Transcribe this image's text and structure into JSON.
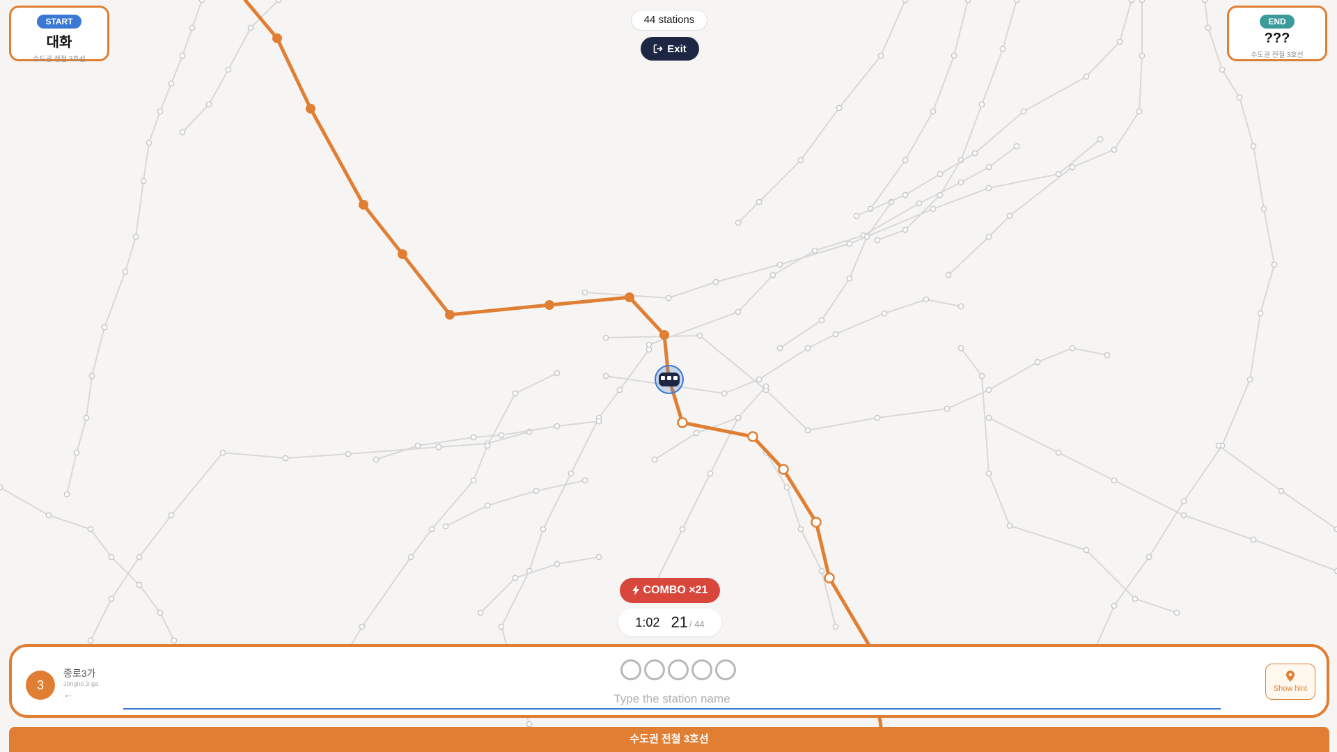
{
  "start": {
    "badge": "START",
    "name": "대화",
    "line": "수도권 전철 3호선"
  },
  "end": {
    "badge": "END",
    "name": "???",
    "line": "수도권 전철 3호선"
  },
  "header": {
    "stations_count": "44 stations",
    "exit_label": "Exit"
  },
  "combo": {
    "label": "COMBO ×21"
  },
  "status": {
    "timer": "1:02",
    "found": "21",
    "total_text": "/ 44"
  },
  "previous_station": {
    "number": "3",
    "name": "종로3가",
    "romanized": "Jongno 3-ga",
    "arrow": "←"
  },
  "answer": {
    "slot_count": 5,
    "placeholder": "Type the station name"
  },
  "hint": {
    "label": "Show hint",
    "icon": "pin-icon"
  },
  "line_bar": {
    "label": "수도권 전철 3호선"
  },
  "colors": {
    "accent": "#e07f33",
    "start_badge": "#3a78d4",
    "end_badge": "#3b9b99",
    "combo": "#d9473c",
    "exit_button": "#1d2744",
    "background_lines": "#d8d8d8"
  }
}
